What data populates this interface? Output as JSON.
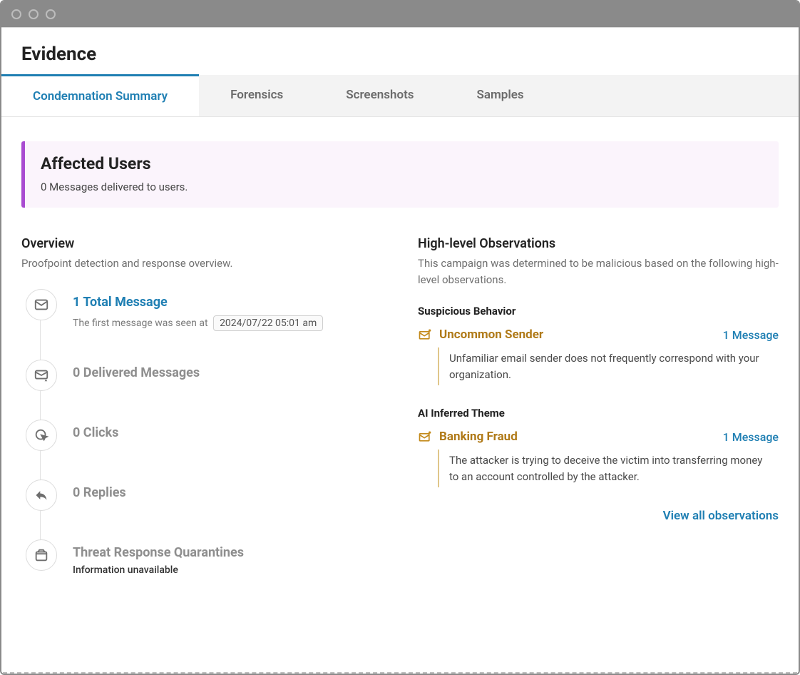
{
  "page": {
    "title": "Evidence"
  },
  "tabs": [
    {
      "label": "Condemnation Summary",
      "active": true
    },
    {
      "label": "Forensics",
      "active": false
    },
    {
      "label": "Screenshots",
      "active": false
    },
    {
      "label": "Samples",
      "active": false
    }
  ],
  "banner": {
    "title": "Affected Users",
    "subtitle": "0 Messages delivered to users."
  },
  "overview": {
    "title": "Overview",
    "subtitle": "Proofpoint detection and response overview.",
    "items": {
      "total": {
        "label": "1 Total Message",
        "detail_prefix": "The first message was seen at",
        "timestamp": "2024/07/22 05:01 am"
      },
      "delivered": {
        "label": "0 Delivered Messages"
      },
      "clicks": {
        "label": "0 Clicks"
      },
      "replies": {
        "label": "0 Replies"
      },
      "quarantine": {
        "label": "Threat Response Quarantines",
        "detail": "Information unavailable"
      }
    }
  },
  "observations": {
    "title": "High-level Observations",
    "subtitle": "This campaign was determined to be malicious based on the following high-level observations.",
    "groups": {
      "suspicious": {
        "heading": "Suspicious Behavior",
        "item": {
          "name": "Uncommon Sender",
          "count": "1 Message",
          "desc": "Unfamiliar email sender does not frequently correspond with your organization."
        }
      },
      "ai": {
        "heading": "AI Inferred Theme",
        "item": {
          "name": "Banking Fraud",
          "count": "1 Message",
          "desc": "The attacker is trying to deceive the victim into transferring money to an account controlled by the attacker."
        }
      }
    },
    "view_all": "View all observations"
  }
}
